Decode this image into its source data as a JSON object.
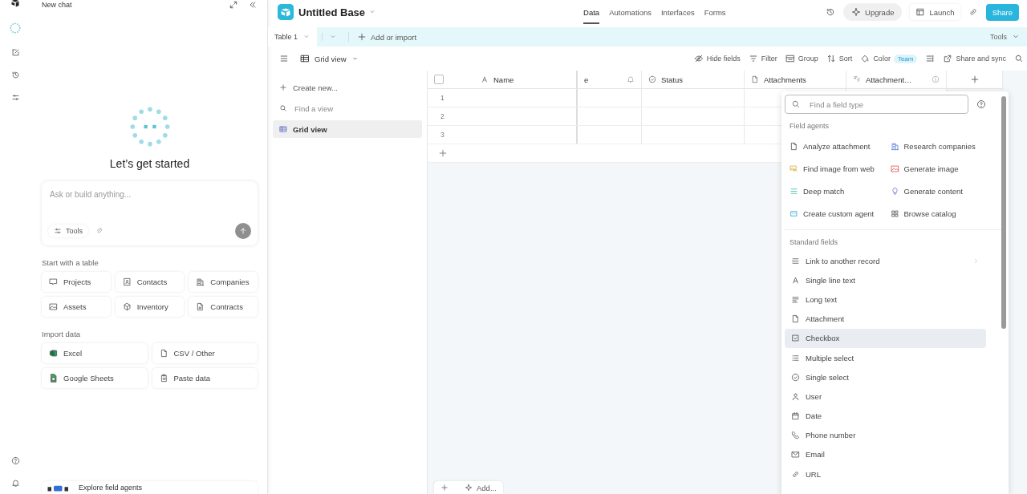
{
  "chat": {
    "title": "New chat",
    "heading": "Let’s get started",
    "input": {
      "placeholder": "Ask or build anything..."
    },
    "tools_button": "Tools",
    "start_section": {
      "title": "Start with a table",
      "items": [
        "Projects",
        "Contacts",
        "Companies",
        "Assets",
        "Inventory",
        "Contracts"
      ]
    },
    "import_section": {
      "title": "Import data",
      "items": [
        "Excel",
        "CSV / Other",
        "Google Sheets",
        "Paste data"
      ]
    },
    "promo": "Explore field agents"
  },
  "topbar": {
    "base_name": "Untitled Base",
    "tabs": [
      {
        "label": "Data",
        "selected": true
      },
      {
        "label": "Automations",
        "selected": false
      },
      {
        "label": "Interfaces",
        "selected": false
      },
      {
        "label": "Forms",
        "selected": false
      }
    ],
    "upgrade": "Upgrade",
    "launch": "Launch",
    "share": "Share"
  },
  "table_tabs": {
    "tabs": [
      {
        "label": "Table 1",
        "selected": true
      }
    ],
    "add": "Add or import",
    "tools": "Tools"
  },
  "view_bar": {
    "view": "Grid view",
    "actions": [
      {
        "label": "Hide fields"
      },
      {
        "label": "Filter"
      },
      {
        "label": "Group"
      },
      {
        "label": "Sort"
      },
      {
        "label": "Color",
        "badge": "Team"
      },
      {
        "label": "Share and sync"
      }
    ]
  },
  "views_sidebar": {
    "create": "Create new...",
    "search": {
      "placeholder": "Find a view"
    },
    "views": [
      {
        "label": "Grid view",
        "selected": true
      }
    ]
  },
  "grid": {
    "select_all_checked": false,
    "columns": [
      {
        "label": "Name"
      },
      {
        "label": "e"
      },
      {
        "label": "Status"
      },
      {
        "label": "Attachments"
      },
      {
        "label": "Attachment…"
      }
    ],
    "rows": [
      "1",
      "2",
      "3"
    ],
    "add_button": "Add..."
  },
  "field_picker": {
    "search": {
      "placeholder": "Find a field type"
    },
    "agents_title": "Field agents",
    "agents": [
      "Analyze attachment",
      "Research companies",
      "Find image from web",
      "Generate image",
      "Deep match",
      "Generate content",
      "Create custom agent",
      "Browse catalog"
    ],
    "standard_title": "Standard fields",
    "fields": [
      {
        "label": "Link to another record",
        "submenu": true,
        "highlighted": false
      },
      {
        "label": "Single line text",
        "submenu": false,
        "highlighted": false
      },
      {
        "label": "Long text",
        "submenu": false,
        "highlighted": false
      },
      {
        "label": "Attachment",
        "submenu": false,
        "highlighted": false
      },
      {
        "label": "Checkbox",
        "submenu": false,
        "highlighted": true
      },
      {
        "label": "Multiple select",
        "submenu": false,
        "highlighted": false
      },
      {
        "label": "Single select",
        "submenu": false,
        "highlighted": false
      },
      {
        "label": "User",
        "submenu": false,
        "highlighted": false
      },
      {
        "label": "Date",
        "submenu": false,
        "highlighted": false
      },
      {
        "label": "Phone number",
        "submenu": false,
        "highlighted": false
      },
      {
        "label": "Email",
        "submenu": false,
        "highlighted": false
      },
      {
        "label": "URL",
        "submenu": false,
        "highlighted": false
      }
    ]
  }
}
